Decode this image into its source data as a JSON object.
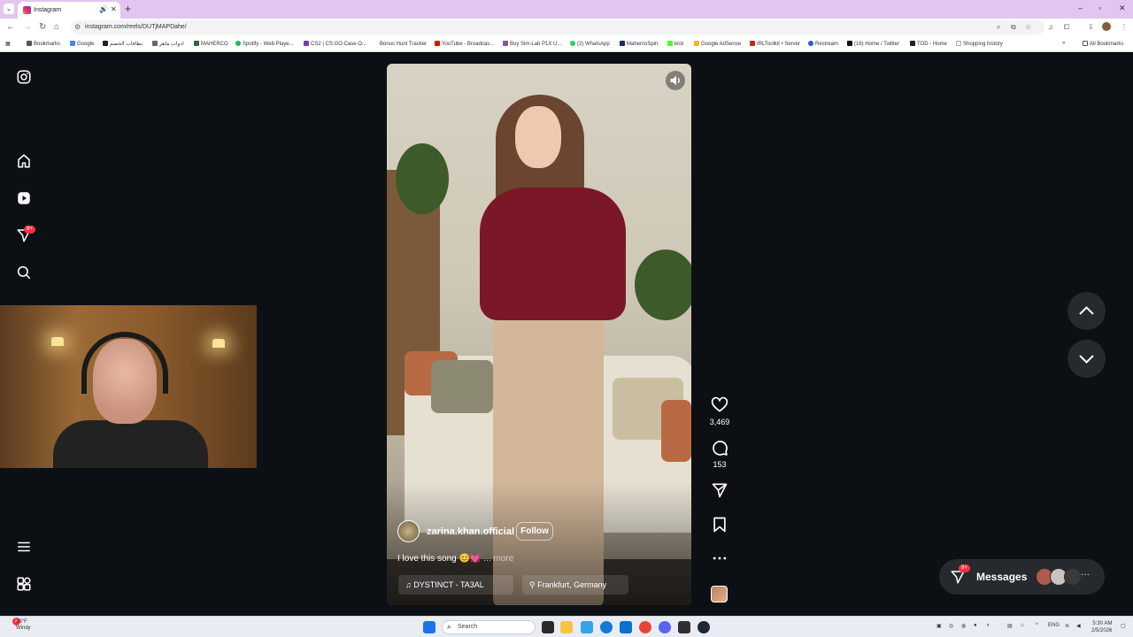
{
  "browser": {
    "tab_title": "Instagram",
    "new_tab_symbol": "+",
    "url": "instagram.com/reels/DUTjMAPDahe/",
    "window_controls": [
      "–",
      "▫",
      "✕"
    ]
  },
  "bookmarks": {
    "items": [
      {
        "label": "Bookmarks",
        "color": "#555555"
      },
      {
        "label": "Google",
        "color": "#4285f4"
      },
      {
        "label": "بطاقات الخصم",
        "color": "#222222"
      },
      {
        "label": "ادوات ماهر",
        "color": "#666666"
      },
      {
        "label": "MAHERCO",
        "color": "#2a6a3a"
      },
      {
        "label": "Spotify - Web Playe...",
        "color": "#1db954"
      },
      {
        "label": "CS2 | CS:GO Case O...",
        "color": "#7a3ab8"
      },
      {
        "label": "Bonus Hunt Tracker",
        "color": "#ffffff"
      },
      {
        "label": "YouTube - Broadcas...",
        "color": "#ff0000"
      },
      {
        "label": "Buy Sim-Lab P1X U...",
        "color": "#8855aa"
      },
      {
        "label": "(2) WhatsApp",
        "color": "#25d366"
      },
      {
        "label": "MahercoSpin",
        "color": "#1a2a6a"
      },
      {
        "label": "kick",
        "color": "#53fc18"
      },
      {
        "label": "Google AdSense",
        "color": "#fbbc04"
      },
      {
        "label": "IRLToolkit • Server",
        "color": "#cc2222"
      },
      {
        "label": "Restream",
        "color": "#2a5adf"
      },
      {
        "label": "(16) Home / Twitter",
        "color": "#111111"
      },
      {
        "label": "TOD - Home",
        "color": "#222222"
      },
      {
        "label": "Shopping history",
        "color": "#ffffff"
      }
    ],
    "overflow": "»",
    "all_bookmarks": "All Bookmarks"
  },
  "sidebar": {
    "icons": [
      "instagram-logo-icon",
      "home-icon",
      "reels-icon",
      "messages-icon",
      "search-icon",
      "menu-icon",
      "apps-icon"
    ],
    "messages_badge": "9+"
  },
  "reel": {
    "username": "zarina.khan.official",
    "follow_label": "Follow",
    "caption": "I love this song 😊💓",
    "more_label": "... more",
    "audio": "DYSTINCT - TA3AL",
    "location": "Frankfurt, Germany",
    "likes": "3,469",
    "comments": "153"
  },
  "messages": {
    "label": "Messages",
    "badge": "9+",
    "more": "···"
  },
  "taskbar": {
    "weather_temp": "33°F",
    "weather_desc": "Windy",
    "weather_badge": "2",
    "search_label": "Search",
    "lang": "ENG",
    "time": "5:30 AM",
    "date": "2/5/2026"
  },
  "colors": {
    "page_bg": "#0c1014",
    "badge": "#ff3040",
    "tabbar": "#e2c5f0"
  }
}
